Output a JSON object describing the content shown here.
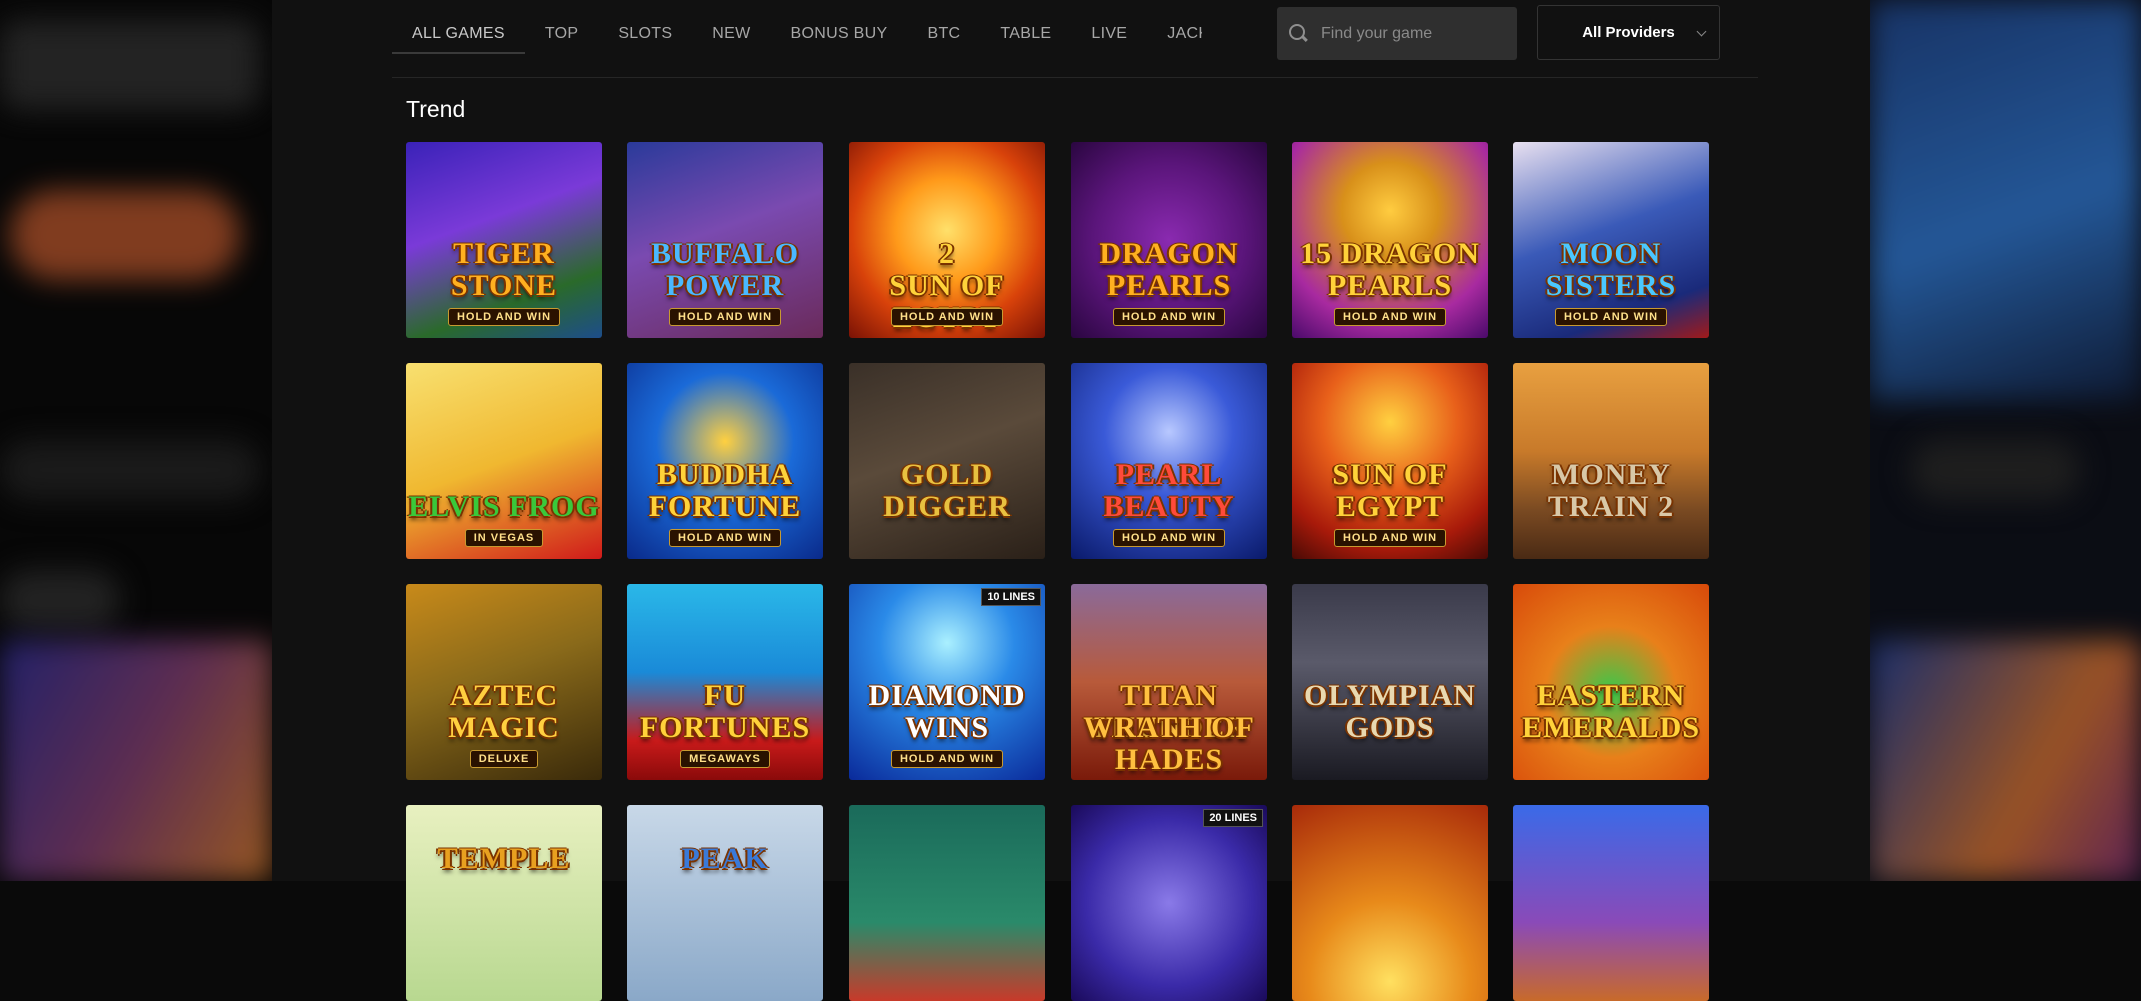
{
  "nav": {
    "tabs": [
      {
        "label": "ALL GAMES",
        "active": true
      },
      {
        "label": "TOP",
        "active": false
      },
      {
        "label": "SLOTS",
        "active": false
      },
      {
        "label": "NEW",
        "active": false
      },
      {
        "label": "BONUS BUY",
        "active": false
      },
      {
        "label": "BTC",
        "active": false
      },
      {
        "label": "TABLE",
        "active": false
      },
      {
        "label": "LIVE",
        "active": false
      },
      {
        "label": "JACKPOT",
        "active": false
      }
    ],
    "search_placeholder": "Find your game",
    "providers_label": "All Providers"
  },
  "section": {
    "title": "Trend"
  },
  "games": [
    {
      "t1": "Tiger",
      "t2": "Stone",
      "t3": "HOLD AND WIN",
      "bg": "linear-gradient(160deg,#3a22b8 0%,#7a3ad8 40%,#2a6a2a 75%,#1d4d8a 100%)",
      "color": "#ffb020"
    },
    {
      "t1": "Buffalo",
      "t2": "Power",
      "t3": "HOLD AND WIN",
      "bg": "linear-gradient(160deg,#2a3a9a 0%,#7a4ab0 45%,#6a2a5a 100%)",
      "color": "#4ab8ff"
    },
    {
      "t1": "2",
      "t2": "Sun of Egypt",
      "t3": "HOLD AND WIN",
      "bg": "radial-gradient(circle at 50% 45%,#ffe06a 0%,#ff9a1a 35%,#d8420a 65%,#7a1205 100%)",
      "color": "#ffd23a"
    },
    {
      "t1": "Dragon",
      "t2": "Pearls",
      "t3": "HOLD AND WIN",
      "bg": "radial-gradient(circle at 50% 50%,#8a2ab0 0%,#5a157a 55%,#2a0640 100%)",
      "color": "#ffb020"
    },
    {
      "t1": "15 Dragon",
      "t2": "Pearls",
      "t3": "HOLD AND WIN",
      "bg": "radial-gradient(circle at 50% 35%,#ffcc40 0%,#d8901a 30%,#a82aa0 70%,#4a0a6a 100%)",
      "color": "#ffd23a"
    },
    {
      "t1": "Moon",
      "t2": "Sisters",
      "t3": "HOLD AND WIN",
      "bg": "linear-gradient(160deg,#e8e0f0 0%,#3a5ab8 45%,#1a2a7a 80%,#a01a1a 100%)",
      "color": "#4ac8ff"
    },
    {
      "t1": "Elvis Frog",
      "t2": "",
      "t3": "IN VEGAS",
      "bg": "linear-gradient(160deg,#f8e070 0%,#f0b830 50%,#d01a1a 100%)",
      "color": "#3ac83a"
    },
    {
      "t1": "Buddha",
      "t2": "Fortune",
      "t3": "HOLD AND WIN",
      "bg": "radial-gradient(circle at 50% 40%,#ffd040 0%,#1a6ad8 45%,#0a2a8a 100%)",
      "color": "#ffd23a"
    },
    {
      "t1": "Gold",
      "t2": "Digger",
      "t3": "",
      "bg": "linear-gradient(160deg,#3a3028 0%,#5a4a3a 45%,#2a2018 100%)",
      "color": "#e8c040"
    },
    {
      "t1": "Pearl",
      "t2": "Beauty",
      "t3": "HOLD AND WIN",
      "bg": "radial-gradient(circle at 50% 35%,#b8c8ff 0%,#3a5ad8 40%,#0a1a6a 100%)",
      "color": "#ff4a3a"
    },
    {
      "t1": "Sun of",
      "t2": "Egypt",
      "t3": "HOLD AND WIN",
      "bg": "radial-gradient(circle at 50% 30%,#ffd040 0%,#e8601a 40%,#a81a0a 75%,#4a0a05 100%)",
      "color": "#ffd23a"
    },
    {
      "t1": "Money",
      "t2": "Train 2",
      "t3": "",
      "bg": "linear-gradient(180deg,#e8a040 0%,#c87a2a 45%,#7a4a22 75%,#4a2a14 100%)",
      "color": "#d8c8a8"
    },
    {
      "t1": "Aztec",
      "t2": "Magic",
      "t3": "DELUXE",
      "bg": "linear-gradient(160deg,#c88a1a 0%,#8a6a1a 45%,#3a2a0a 100%)",
      "color": "#ffd040"
    },
    {
      "t1": "Fu",
      "t2": "Fortunes",
      "t3": "MEGAWAYS",
      "bg": "linear-gradient(180deg,#2ab8e8 0%,#1a8ad8 45%,#c81a1a 80%,#8a0a0a 100%)",
      "color": "#ffd23a"
    },
    {
      "t1": "Diamond",
      "t2": "Wins",
      "t3": "HOLD AND WIN",
      "badge": "10 LINES",
      "bg": "radial-gradient(circle at 50% 30%,#aaf0ff 0%,#2a8ae8 40%,#0a2a9a 100%)",
      "color": "#ffffff"
    },
    {
      "t1": "Titan Thunder",
      "t2": "Wrath of Hades",
      "t3": "",
      "bg": "linear-gradient(180deg,#8a6a9a 0%,#b85a3a 50%,#7a1a0a 100%)",
      "color": "#ffc040"
    },
    {
      "t1": "Olympian",
      "t2": "Gods",
      "t3": "",
      "bg": "linear-gradient(180deg,#3a3a4a 0%,#5a5a6a 40%,#1a1a22 100%)",
      "color": "#e8d8b0"
    },
    {
      "t1": "Eastern",
      "t2": "Emeralds",
      "t3": "",
      "bg": "radial-gradient(circle at 50% 55%,#3ac84a 0%,#e8801a 45%,#d84a0a 100%)",
      "color": "#ffd23a"
    },
    {
      "t1": "Temple",
      "t2": "",
      "t3": "",
      "bg": "linear-gradient(180deg,#e8f0c0 0%,#b8d890 100%)",
      "color": "#e8a020"
    },
    {
      "t1": "Peak",
      "t2": "",
      "t3": "",
      "bg": "linear-gradient(180deg,#c8d8e8 0%,#8aa8c8 100%)",
      "color": "#3a7ad8"
    },
    {
      "t1": "",
      "t2": "",
      "t3": "",
      "bg": "linear-gradient(180deg,#1a6a5a 0%,#2a8a6a 60%,#c83a2a 100%)",
      "color": "#ffffff"
    },
    {
      "t1": "",
      "t2": "",
      "t3": "",
      "badge": "20 LINES",
      "bg": "radial-gradient(circle at 50% 50%,#8a7ae8 0%,#3a2aa8 60%,#1a0a5a 100%)",
      "color": "#ffffff"
    },
    {
      "t1": "",
      "t2": "",
      "t3": "",
      "bg": "radial-gradient(circle at 50% 90%,#ffe060 0%,#e88a1a 40%,#a82a0a 100%)",
      "color": "#ffd23a"
    },
    {
      "t1": "",
      "t2": "",
      "t3": "",
      "bg": "linear-gradient(180deg,#3a6ae8 0%,#8a4ab8 60%,#c86a2a 100%)",
      "color": "#ffd23a"
    }
  ]
}
